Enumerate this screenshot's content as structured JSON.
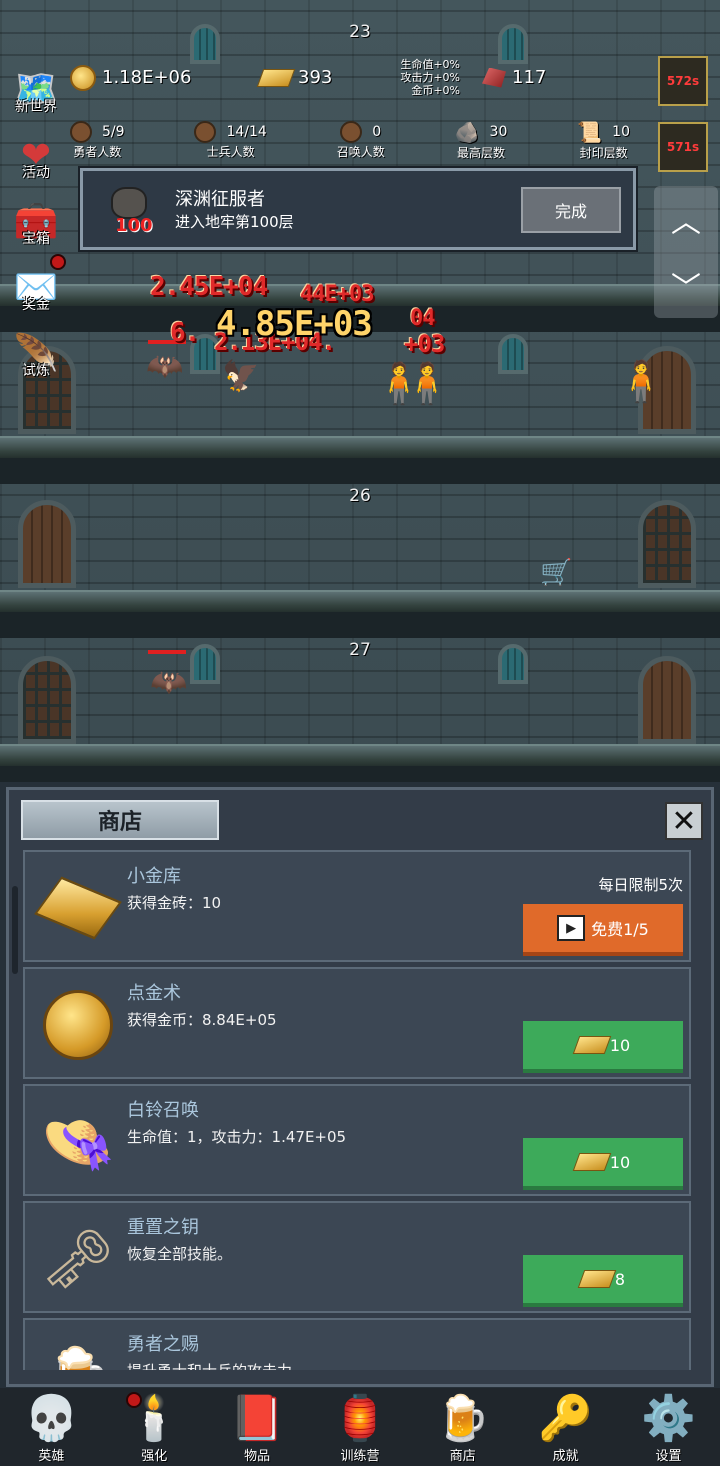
{
  "floors": {
    "f23": "23",
    "f26": "26",
    "f27": "27"
  },
  "hud": {
    "gold_coins": "1.18E+06",
    "gold_bars": "393",
    "bonus_hp": "生命值+0%",
    "bonus_atk": "攻击力+0%",
    "bonus_gold": "金币+0%",
    "gems": "117",
    "heroes_value": "5/9",
    "heroes_label": "勇者人数",
    "soldiers_value": "14/14",
    "soldiers_label": "士兵人数",
    "summons_value": "0",
    "summons_label": "召唤人数",
    "max_floor_value": "30",
    "max_floor_label": "最高层数",
    "sealed_floor_value": "10",
    "sealed_floor_label": "封印层数"
  },
  "left_menu": [
    "新世界",
    "活动",
    "宝箱",
    "奖金",
    "试炼"
  ],
  "timers": [
    "572s",
    "571s"
  ],
  "achievement": {
    "badge": "100",
    "title": "深渊征服者",
    "desc": "进入地牢第100层",
    "button": "完成"
  },
  "damage": {
    "d1": "2.45E+04",
    "d2": "4.85E+03",
    "d3": "6.",
    "d4": "2.13E+04.",
    "d5": "44E+03",
    "d6": "04",
    "d7": "+03"
  },
  "shop": {
    "title": "商店",
    "items": [
      {
        "name": "小金库",
        "desc": "获得金砖：10",
        "limit": "每日限制5次",
        "price": "免费1/5"
      },
      {
        "name": "点金术",
        "desc": "获得金币：8.84E+05",
        "price": "10"
      },
      {
        "name": "白铃召唤",
        "desc": "生命值：1，攻击力：1.47E+05",
        "price": "10"
      },
      {
        "name": "重置之钥",
        "desc": "恢复全部技能。",
        "price": "8"
      },
      {
        "name": "勇者之赐",
        "desc": "提升勇士和士兵的攻击力。"
      }
    ]
  },
  "nav": [
    "英雄",
    "强化",
    "物品",
    "训练营",
    "商店",
    "成就",
    "设置"
  ],
  "colors": {
    "buy_green": "#3daa5a",
    "ad_orange": "#e06a2a",
    "panel": "#333c48"
  }
}
